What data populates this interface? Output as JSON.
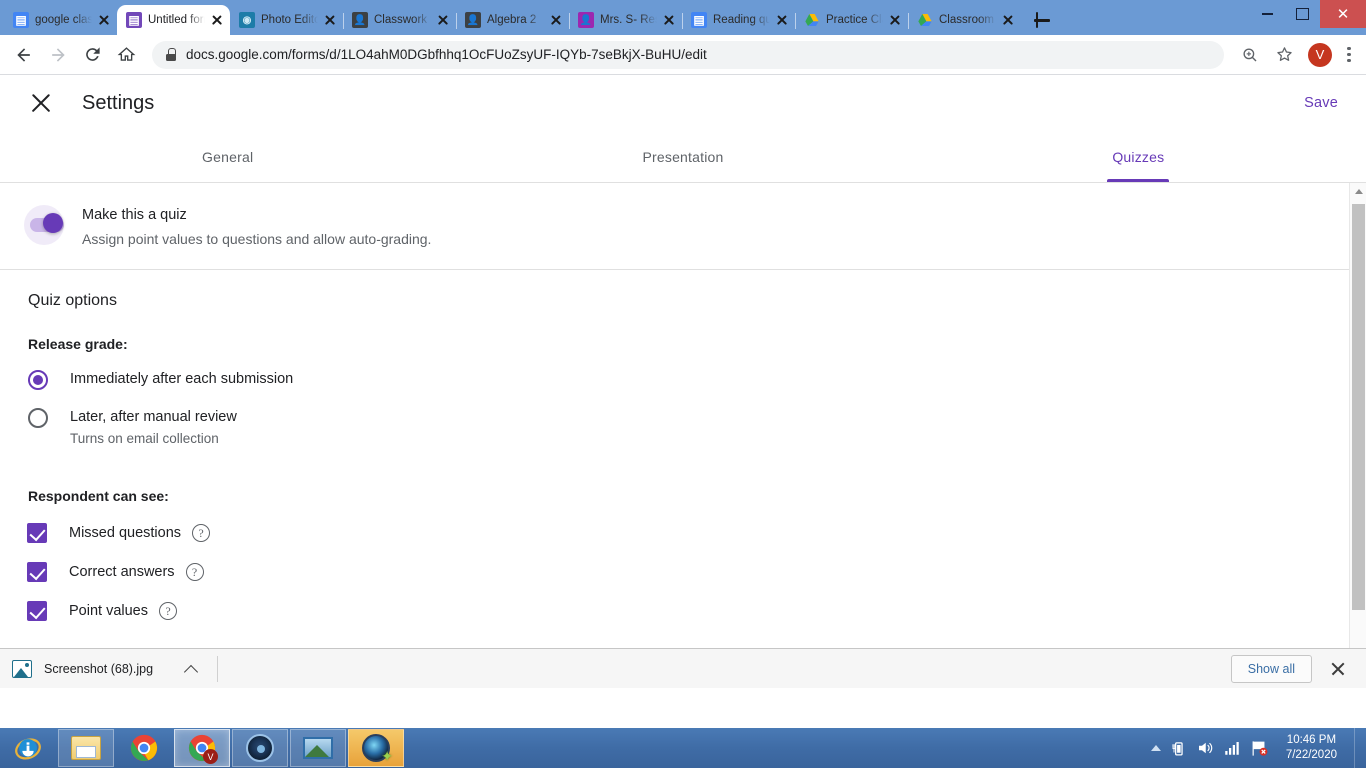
{
  "browser": {
    "tabs": [
      {
        "title": "google class",
        "favicon": "google-classroom-icon",
        "active": false
      },
      {
        "title": "Untitled form",
        "favicon": "google-forms-icon",
        "active": true
      },
      {
        "title": "Photo Editor",
        "favicon": "photo-editor-icon",
        "active": false
      },
      {
        "title": "Classwork fo",
        "favicon": "contact-icon",
        "active": false
      },
      {
        "title": "Algebra 2",
        "favicon": "contact-icon",
        "active": false
      },
      {
        "title": "Mrs. S- Reso",
        "favicon": "contact-purple-icon",
        "active": false
      },
      {
        "title": "Reading que",
        "favicon": "google-classroom-icon",
        "active": false
      },
      {
        "title": "Practice Clas",
        "favicon": "google-drive-icon",
        "active": false
      },
      {
        "title": "Classroom -",
        "favicon": "google-drive-icon",
        "active": false
      }
    ],
    "new_tab_label": "+",
    "window_controls": {
      "minimize": "–",
      "maximize": "▢",
      "close": "✕"
    },
    "url": "docs.google.com/forms/d/1LO4ahM0DGbfhhq1OcFUoZsyUF-IQYb-7seBkjX-BuHU/edit",
    "avatar_initial": "V",
    "accent_blue": "#6b9ad4"
  },
  "settings": {
    "title": "Settings",
    "save_label": "Save",
    "accent_purple": "#673ab7",
    "tabs": [
      {
        "label": "General",
        "active": false
      },
      {
        "label": "Presentation",
        "active": false
      },
      {
        "label": "Quizzes",
        "active": true
      }
    ],
    "quiz_toggle": {
      "label": "Make this a quiz",
      "description": "Assign point values to questions and allow auto-grading.",
      "state": "on"
    },
    "quiz_options_title": "Quiz options",
    "release_grade": {
      "heading": "Release grade:",
      "options": [
        {
          "label": "Immediately after each submission",
          "sub": "",
          "selected": true
        },
        {
          "label": "Later, after manual review",
          "sub": "Turns on email collection",
          "selected": false
        }
      ]
    },
    "respondent_can_see": {
      "heading": "Respondent can see:",
      "items": [
        {
          "label": "Missed questions",
          "checked": true,
          "help": "?"
        },
        {
          "label": "Correct answers",
          "checked": true,
          "help": "?"
        },
        {
          "label": "Point values",
          "checked": true,
          "help": "?"
        }
      ]
    }
  },
  "downloads": {
    "file_name": "Screenshot (68).jpg",
    "show_all_label": "Show all"
  },
  "taskbar": {
    "apps": [
      {
        "name": "internet-explorer",
        "state": "plain"
      },
      {
        "name": "file-explorer",
        "state": "boxed"
      },
      {
        "name": "chrome",
        "state": "plain"
      },
      {
        "name": "chrome-active",
        "state": "active"
      },
      {
        "name": "media-player",
        "state": "boxed"
      },
      {
        "name": "photo-viewer",
        "state": "boxed"
      },
      {
        "name": "photo-editor",
        "state": "orange"
      }
    ],
    "clock_time": "10:46 PM",
    "clock_date": "7/22/2020"
  }
}
